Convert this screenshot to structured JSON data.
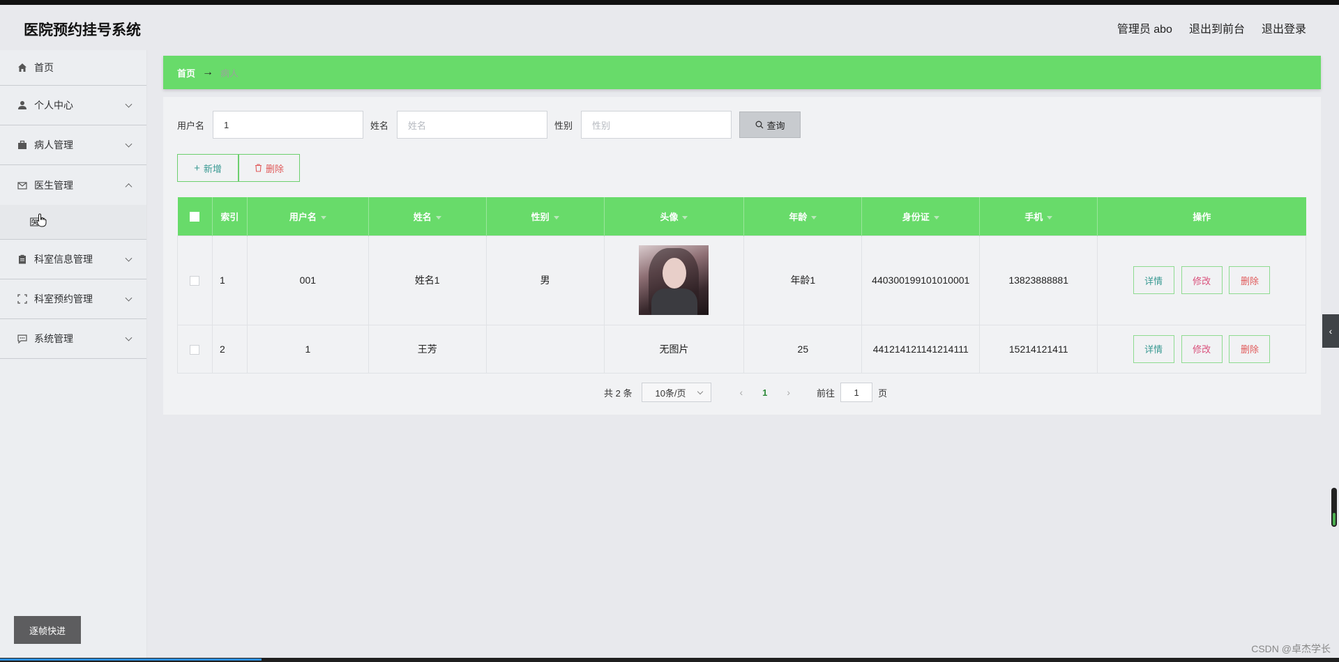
{
  "app": {
    "title": "医院预约挂号系统"
  },
  "header": {
    "admin": "管理员 abo",
    "to_front": "退出到前台",
    "logout": "退出登录"
  },
  "sidebar": {
    "items": [
      {
        "label": "首页"
      },
      {
        "label": "个人中心"
      },
      {
        "label": "病人管理"
      },
      {
        "label": "医生管理"
      },
      {
        "label": "科室信息管理"
      },
      {
        "label": "科室预约管理"
      },
      {
        "label": "系统管理"
      }
    ],
    "submenu_label": "医",
    "frame_button": "逐帧快进"
  },
  "breadcrumb": {
    "home": "首页",
    "arrow": "→",
    "current": "病人"
  },
  "search": {
    "username_label": "用户名",
    "username_value": "1",
    "name_label": "姓名",
    "name_placeholder": "姓名",
    "gender_label": "性别",
    "gender_placeholder": "性别",
    "query_label": "查询"
  },
  "actions": {
    "add": "新增",
    "delete": "删除"
  },
  "table": {
    "headers": [
      "索引",
      "用户名",
      "姓名",
      "性别",
      "头像",
      "年龄",
      "身份证",
      "手机",
      "操作"
    ],
    "rows": [
      {
        "index": "1",
        "username": "001",
        "name": "姓名1",
        "gender": "男",
        "avatar": "",
        "age": "年龄1",
        "id_card": "440300199101010001",
        "phone": "13823888881"
      },
      {
        "index": "2",
        "username": "1",
        "name": "王芳",
        "gender": "",
        "avatar": "无图片",
        "age": "25",
        "id_card": "441214121141214111",
        "phone": "15214121411"
      }
    ],
    "row_actions": {
      "detail": "详情",
      "edit": "修改",
      "delete": "删除"
    }
  },
  "pagination": {
    "total": "共 2 条",
    "page_size": "10条/页",
    "current": "1",
    "goto_label": "前往",
    "goto_value": "1",
    "page_suffix": "页"
  },
  "watermark": "CSDN @卓杰学长",
  "colors": {
    "accent_green": "#68db6a",
    "danger": "#e05a5a",
    "info": "#3a9a93"
  }
}
